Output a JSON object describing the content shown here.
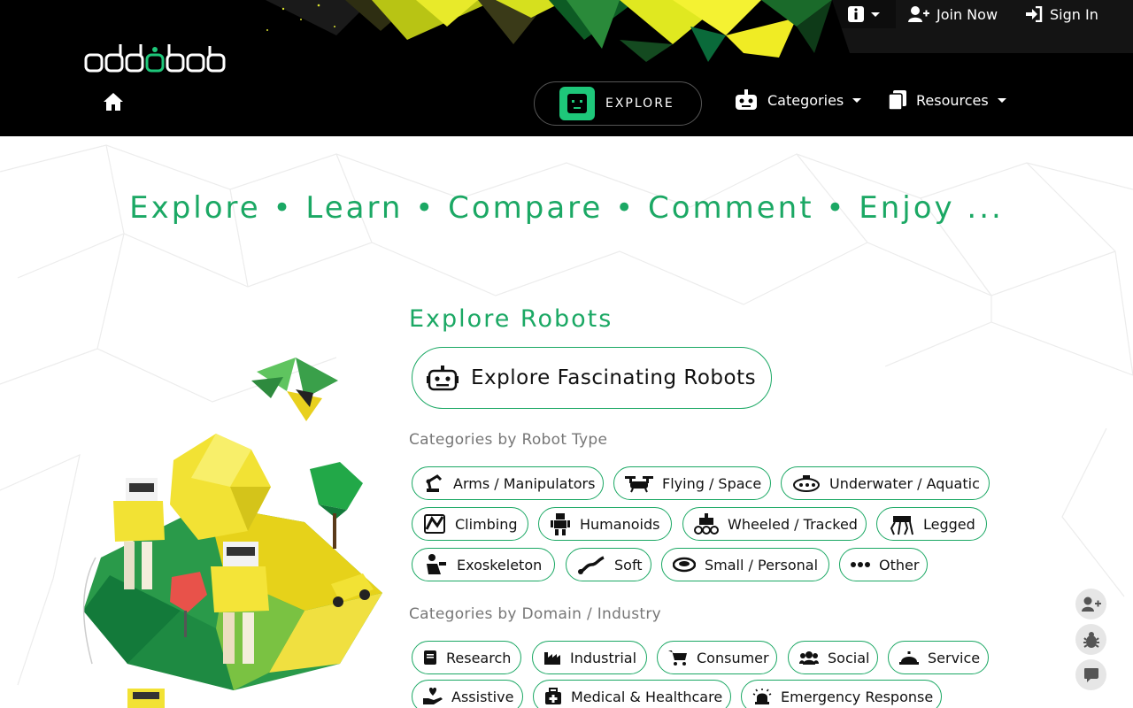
{
  "nav": {
    "logo_text": "oddobot",
    "explore_label": "EXPLORE",
    "categories_label": "Categories",
    "resources_label": "Resources",
    "join_label": "Join Now",
    "signin_label": "Sign In"
  },
  "main": {
    "tagline": "Explore • Learn • Compare • Comment • Enjoy ...",
    "section_title": "Explore Robots",
    "explore_button_label": "Explore Fascinating Robots",
    "robot_type_heading": "Categories by Robot Type",
    "domain_heading": "Categories by Domain / Industry",
    "robot_types": [
      "Arms / Manipulators",
      "Flying / Space",
      "Underwater / Aquatic",
      "Climbing",
      "Humanoids",
      "Wheeled / Tracked",
      "Legged",
      "Exoskeleton",
      "Soft",
      "Small / Personal",
      "Other"
    ],
    "domains": [
      "Research",
      "Industrial",
      "Consumer",
      "Social",
      "Service",
      "Assistive",
      "Medical & Healthcare",
      "Emergency Response"
    ]
  },
  "colors": {
    "accent": "#1ba864",
    "navbar": "#000000"
  },
  "icons": {
    "home": "home-icon",
    "info": "info-icon",
    "join": "user-plus-icon",
    "signin": "sign-in-icon",
    "categories": "robot-icon",
    "resources": "documents-icon",
    "fab_join": "user-plus-icon",
    "fab_bug": "bug-icon",
    "fab_feedback": "comment-icon"
  }
}
